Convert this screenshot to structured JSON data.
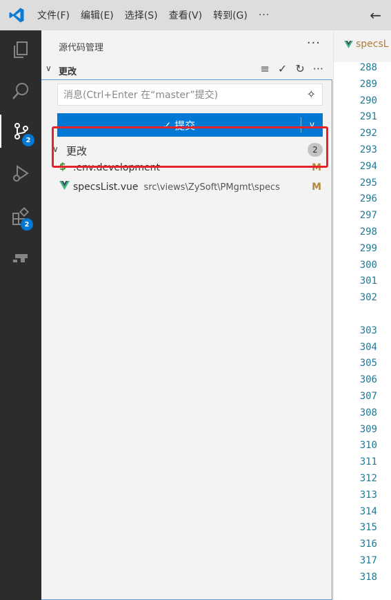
{
  "menu": {
    "items": [
      "文件(F)",
      "编辑(E)",
      "选择(S)",
      "查看(V)",
      "转到(G)"
    ],
    "more": "···"
  },
  "activity_bar": {
    "items": [
      {
        "icon": "explorer-icon"
      },
      {
        "icon": "search-icon"
      },
      {
        "icon": "source-control-icon",
        "badge": "2",
        "active": true
      },
      {
        "icon": "run-debug-icon"
      },
      {
        "icon": "extensions-icon",
        "badge": "2"
      },
      {
        "icon": "remote-explorer-icon"
      }
    ]
  },
  "sidebar": {
    "title": "源代码管理",
    "more": "···",
    "section_title": "更改",
    "commit_input_placeholder": "消息(Ctrl+Enter 在“master”提交)",
    "commit_button_label": "✓ 提交",
    "changes_group": {
      "label": "更改",
      "count": "2"
    },
    "files": [
      {
        "icon": "$",
        "icon_color": "#3c8a2e",
        "name": ".env.development",
        "path": "",
        "status": "M"
      },
      {
        "icon": "V",
        "icon_color": "#41b883",
        "name": "specsList.vue",
        "path": "src\\views\\ZySoft\\PMgmt\\specs",
        "status": "M"
      }
    ]
  },
  "editor": {
    "tab_label": "specsL",
    "line_numbers": [
      "288",
      "289",
      "290",
      "291",
      "292",
      "293",
      "294",
      "295",
      "296",
      "297",
      "298",
      "299",
      "300",
      "301",
      "302",
      "303",
      "304",
      "305",
      "306",
      "307",
      "308",
      "309",
      "310",
      "311",
      "312",
      "313",
      "314",
      "315",
      "316",
      "317",
      "318"
    ]
  },
  "colors": {
    "accent": "#0078d4",
    "highlight": "#e8222b",
    "modified": "#b3893b"
  }
}
